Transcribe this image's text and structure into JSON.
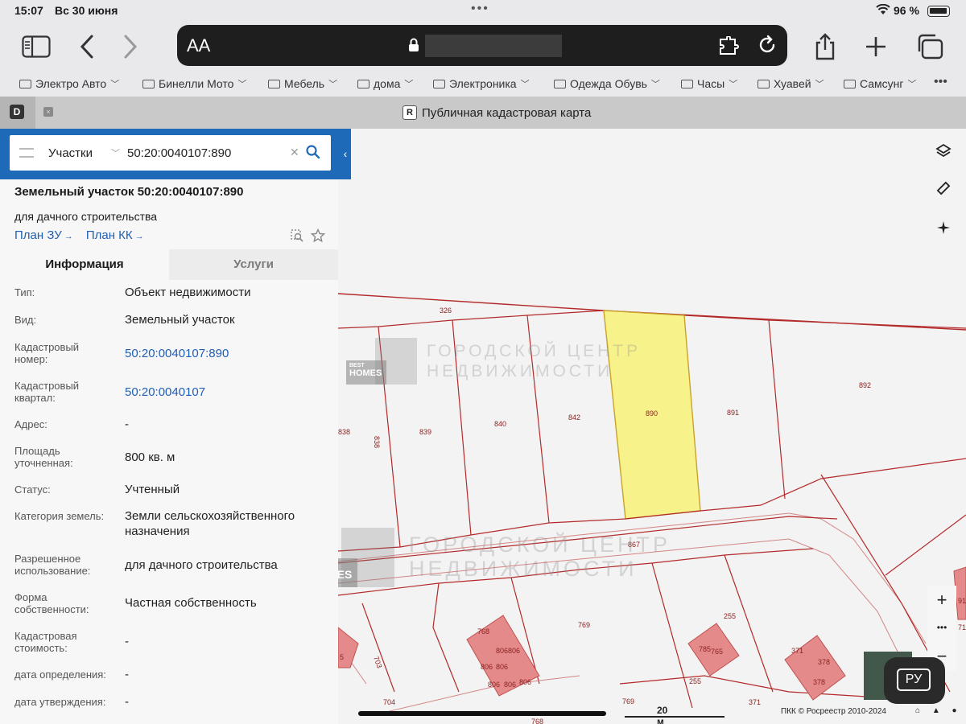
{
  "status_bar": {
    "time": "15:07",
    "date": "Вс 30 июня",
    "battery": "96 %"
  },
  "browser": {
    "aa_label": "AA",
    "bookmarks": [
      "Электро Авто",
      "Бинелли Мото",
      "Мебель",
      "дома",
      "Электроника",
      "Одежда Обувь",
      "Часы",
      "Хуавей",
      "Самсунг"
    ],
    "more": "•••",
    "tab_favicon": "D",
    "tab_close": "×",
    "active_tab_favicon": "R",
    "active_tab_title": "Публичная кадастровая карта"
  },
  "search": {
    "type": "Участки",
    "value": "50:20:0040107:890"
  },
  "object": {
    "title": "Земельный участок 50:20:0040107:890",
    "subtitle": "для дачного строительства",
    "link_plan_zu": "План ЗУ",
    "link_plan_kk": "План КК",
    "tab_info": "Информация",
    "tab_services": "Услуги",
    "rows": [
      {
        "label": "Тип:",
        "value": "Объект недвижимости"
      },
      {
        "label": "Вид:",
        "value": "Земельный участок"
      },
      {
        "label": "Кадастровый номер:",
        "value": "50:20:0040107:890"
      },
      {
        "label": "Кадастровый квартал:",
        "value": "50:20:0040107"
      },
      {
        "label": "Адрес:",
        "value": "-"
      },
      {
        "label": "Площадь уточненная:",
        "value": "800 кв. м"
      },
      {
        "label": "Статус:",
        "value": "Учтенный"
      },
      {
        "label": "Категория земель:",
        "value": "Земли сельскохозяйственного назначения"
      },
      {
        "label": "Разрешенное использование:",
        "value": "для дачного строительства"
      },
      {
        "label": "Форма собственности:",
        "value": "Частная собственность"
      },
      {
        "label": "Кадастровая стоимость:",
        "value": "-"
      },
      {
        "label": "дата определения:",
        "value": "-"
      },
      {
        "label": "дата утверждения:",
        "value": "-"
      }
    ]
  },
  "map": {
    "plot_labels": [
      "326",
      "838",
      "838",
      "839",
      "840",
      "842",
      "890",
      "891",
      "892",
      "867",
      "768",
      "806",
      "806",
      "806",
      "806",
      "806",
      "806",
      "806",
      "769",
      "255",
      "785",
      "765",
      "255",
      "371",
      "378",
      "378",
      "703",
      "704",
      "768",
      "769",
      "371",
      "5",
      "91",
      "71"
    ],
    "scale": "20 м",
    "copyright": "ПКК © Росреестр 2010-2024",
    "lang_button": "РУ",
    "zoom_in": "+",
    "zoom_more": "•••",
    "zoom_out": "−",
    "watermark_line1": "ГОРОДСКОЙ ЦЕНТР",
    "watermark_line2": "НЕДВИЖИМОСТИ",
    "watermark_badge1": "BEST",
    "watermark_badge2": "HOMES",
    "colors": {
      "selected_plot": "#f7f38a",
      "boundary": "#b32a2a",
      "building": "#e58a8a"
    }
  }
}
